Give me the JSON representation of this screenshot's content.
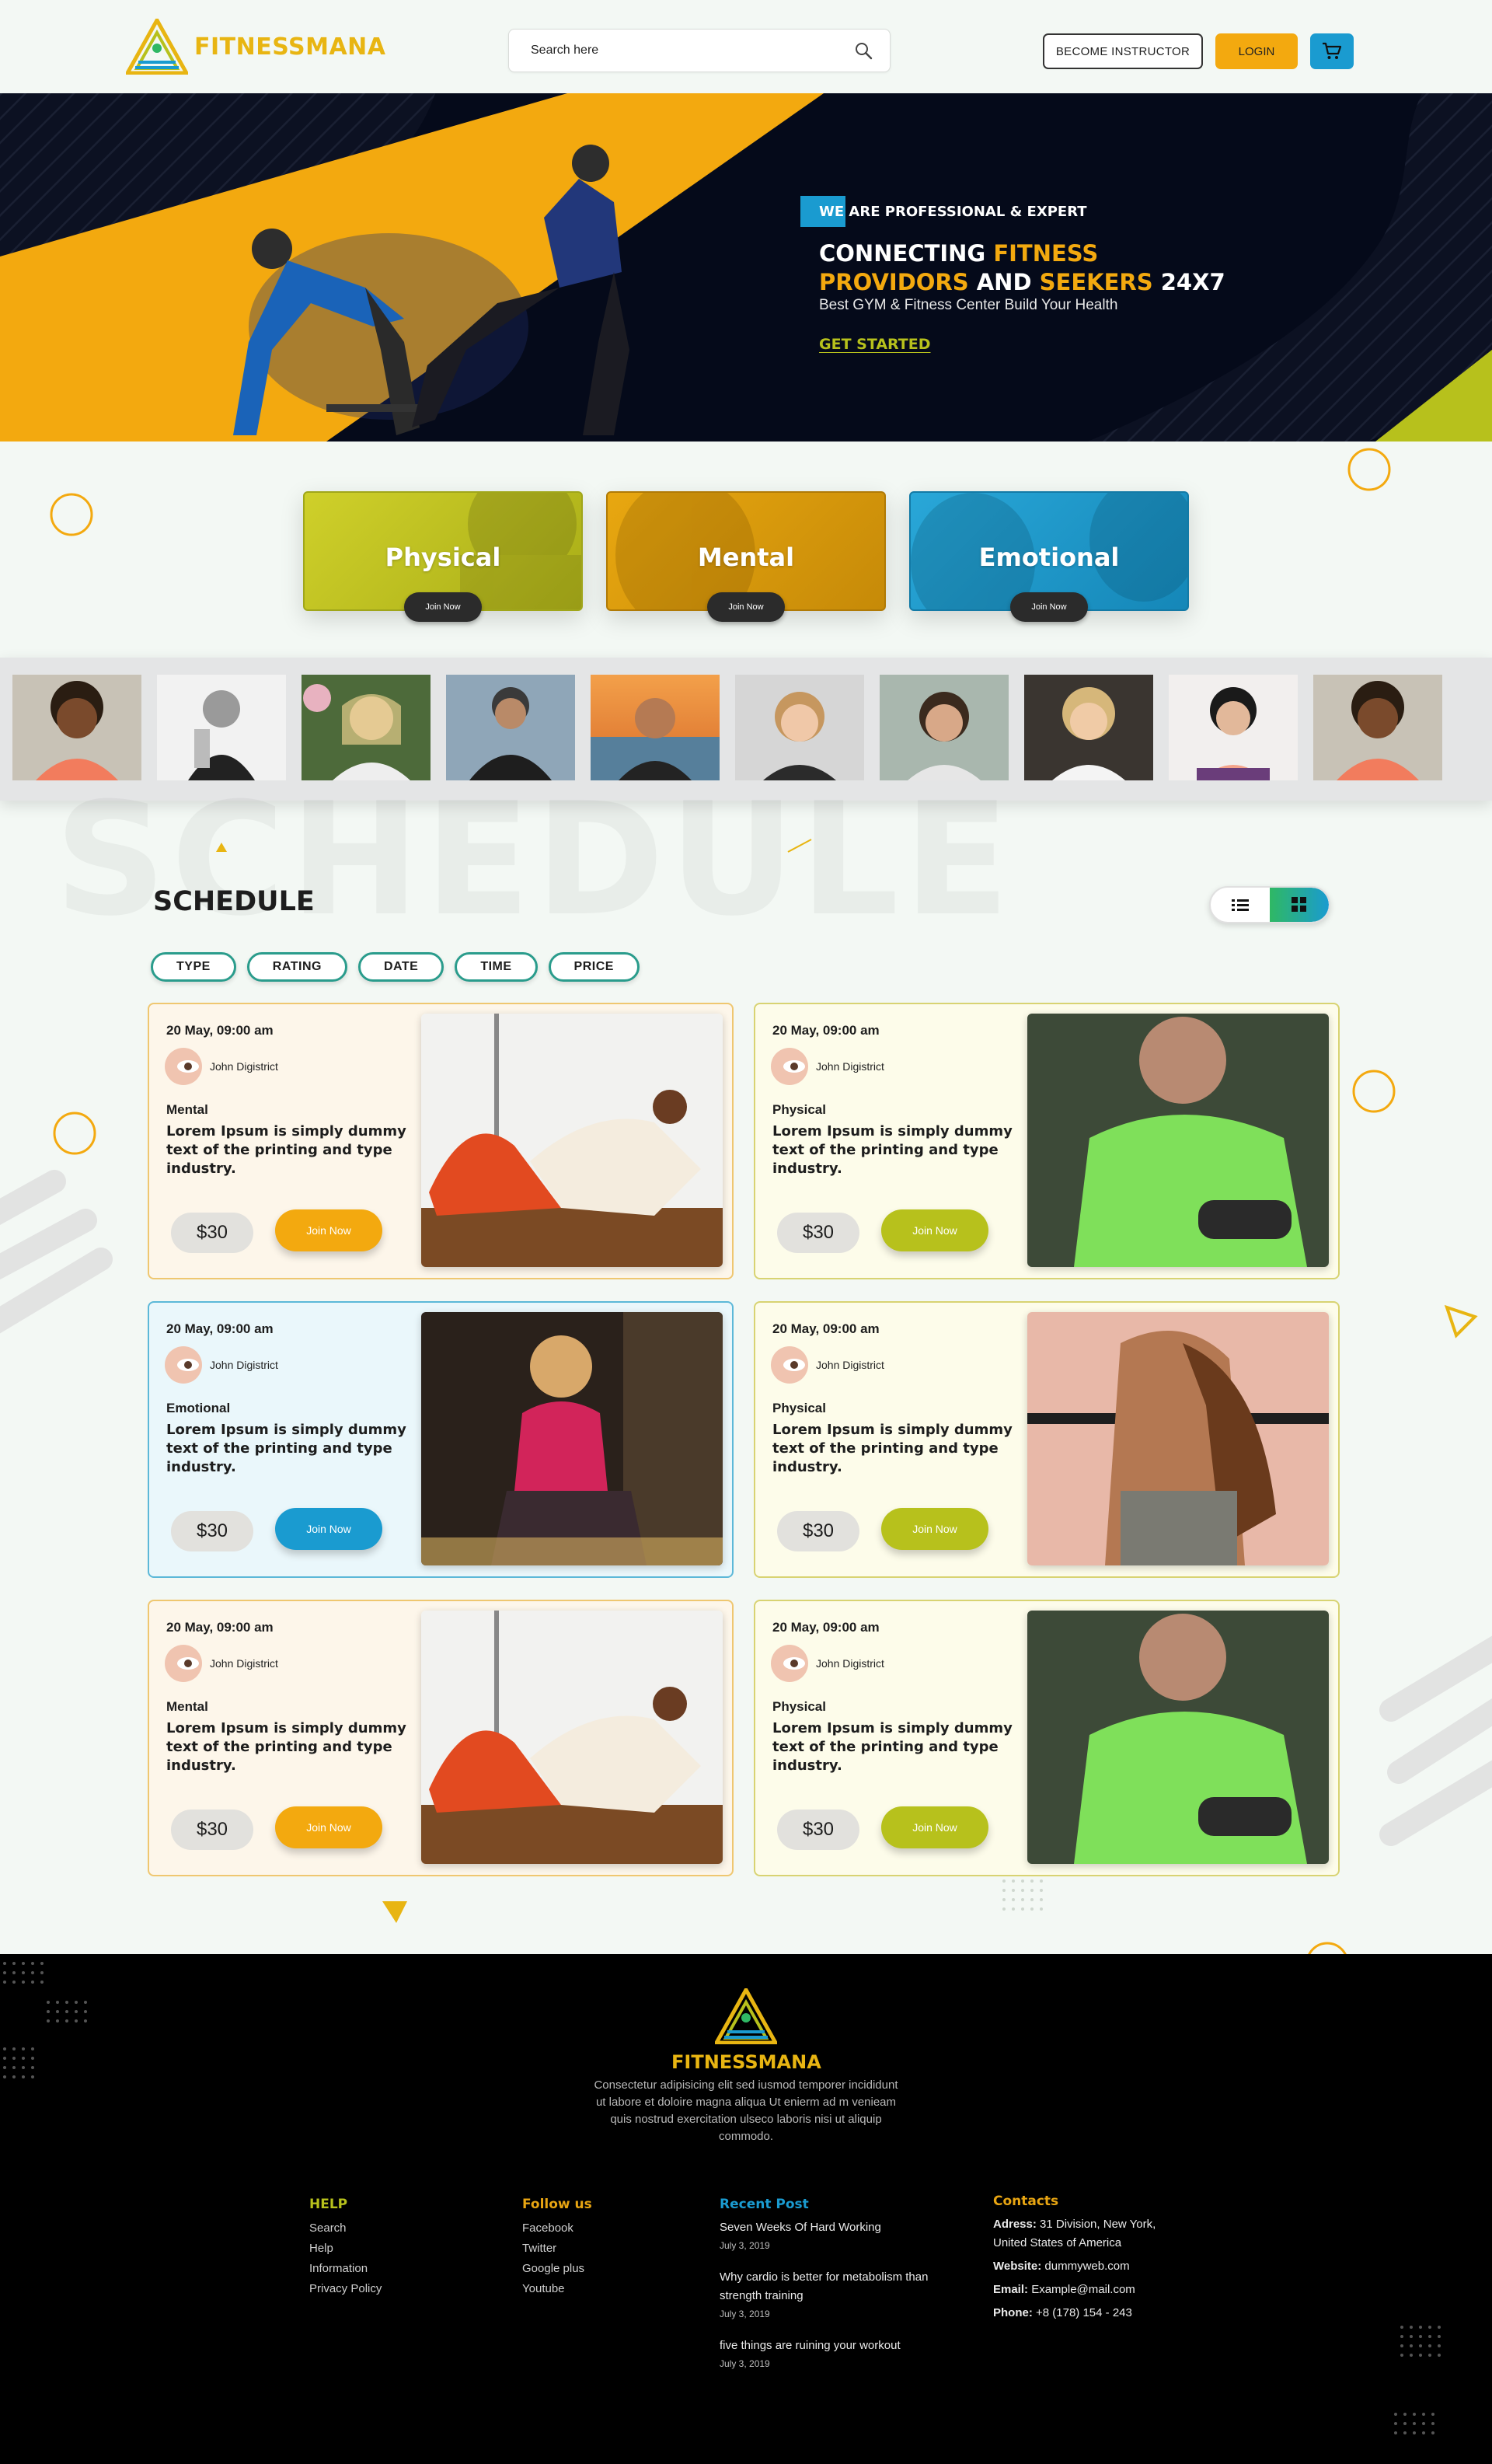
{
  "header": {
    "logo_text": "FITNESSMANA",
    "search_placeholder": "Search here",
    "become_instructor": "BECOME INSTRUCTOR",
    "login": "LOGIN",
    "icons": {
      "search": "search-icon",
      "cart": "cart-icon"
    }
  },
  "hero": {
    "tag_text": "WE ARE PROFESSIONAL & EXPERT",
    "title_line1_a": "CONNECTING ",
    "title_line1_b": "FITNESS",
    "title_line2_a": "PROVIDORS",
    "title_line2_b": " AND ",
    "title_line2_c": "SEEKERS",
    "title_line2_d": " 24X7",
    "subtitle": "Best GYM & Fitness Center Build Your Health",
    "cta": "GET STARTED"
  },
  "categories": [
    {
      "title": "Physical",
      "button": "Join Now",
      "color": "#c2c422"
    },
    {
      "title": "Mental",
      "button": "Join Now",
      "color": "#d89c0c"
    },
    {
      "title": "Emotional",
      "button": "Join Now",
      "color": "#1d9fce"
    }
  ],
  "schedule": {
    "title": "SCHEDULE",
    "watermark": "SCHEDULE",
    "filters": [
      "TYPE",
      "RATING",
      "DATE",
      "TIME",
      "PRICE"
    ],
    "cards": [
      {
        "date": "20 May, 09:00 am",
        "coach": "John Digistrict",
        "category": "Mental",
        "description": "Lorem Ipsum is simply dummy text of the printing and type industry.",
        "price": "$30",
        "button": "Join Now",
        "accent": "#f3a90f"
      },
      {
        "date": "20 May, 09:00 am",
        "coach": "John Digistrict",
        "category": "Physical",
        "description": "Lorem Ipsum is simply dummy text of the printing and type industry.",
        "price": "$30",
        "button": "Join Now",
        "accent": "#b7c11c"
      },
      {
        "date": "20 May, 09:00 am",
        "coach": "John Digistrict",
        "category": "Emotional",
        "description": "Lorem Ipsum is simply dummy text of the printing and type industry.",
        "price": "$30",
        "button": "Join Now",
        "accent": "#1a9bd0"
      },
      {
        "date": "20 May, 09:00 am",
        "coach": "John Digistrict",
        "category": "Physical",
        "description": "Lorem Ipsum is simply dummy text of the printing and type industry.",
        "price": "$30",
        "button": "Join Now",
        "accent": "#b7c11c"
      },
      {
        "date": "20 May, 09:00 am",
        "coach": "John Digistrict",
        "category": "Mental",
        "description": "Lorem Ipsum is simply dummy text of the printing and type industry.",
        "price": "$30",
        "button": "Join Now",
        "accent": "#f3a90f"
      },
      {
        "date": "20 May, 09:00 am",
        "coach": "John Digistrict",
        "category": "Physical",
        "description": "Lorem Ipsum is simply dummy text of the printing and type industry.",
        "price": "$30",
        "button": "Join Now",
        "accent": "#b7c11c"
      }
    ]
  },
  "footer": {
    "logo_text": "FITNESSMANA",
    "description": "Consectetur adipisicing elit sed iusmod temporer incididunt ut labore et doloire magna aliqua Ut enierm ad m venieam quis nostrud exercitation ulseco laboris nisi ut aliquip commodo.",
    "help": {
      "title": "HELP",
      "links": [
        "Search",
        "Help",
        "Information",
        "Privacy Policy"
      ]
    },
    "follow": {
      "title": "Follow us",
      "links": [
        "Facebook",
        "Twitter",
        "Google plus",
        "Youtube"
      ]
    },
    "recent": {
      "title": "Recent Post",
      "posts": [
        {
          "title": "Seven Weeks Of Hard Working",
          "date": "July 3, 2019"
        },
        {
          "title": "Why cardio is better for metabolism than strength training",
          "date": "July 3, 2019"
        },
        {
          "title": "five things are ruining your workout",
          "date": "July 3, 2019"
        }
      ]
    },
    "contacts": {
      "title": "Contacts",
      "address_label": "Adress:",
      "address": "31 Division, New York, United States of America",
      "website_label": "Website:",
      "website": "dummyweb.com",
      "email_label": "Email:",
      "email": "Example@mail.com",
      "phone_label": "Phone:",
      "phone": "+8 (178) 154 - 243"
    }
  },
  "colors": {
    "orange": "#f3a90f",
    "lime": "#b7c11c",
    "blue": "#1a9bd0",
    "dark": "#050a1a"
  }
}
